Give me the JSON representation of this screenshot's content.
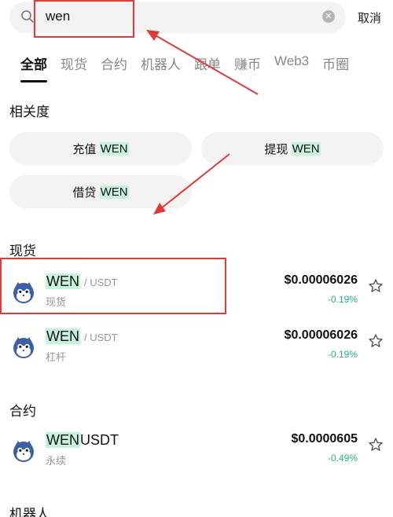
{
  "search": {
    "query": "wen",
    "cancel_label": "取消"
  },
  "tabs": [
    {
      "label": "全部",
      "active": true
    },
    {
      "label": "现货",
      "active": false
    },
    {
      "label": "合约",
      "active": false
    },
    {
      "label": "机器人",
      "active": false
    },
    {
      "label": "跟单",
      "active": false
    },
    {
      "label": "赚币",
      "active": false
    },
    {
      "label": "Web3",
      "active": false
    },
    {
      "label": "币圈",
      "active": false
    }
  ],
  "relevance": {
    "title": "相关度",
    "chips": [
      {
        "prefix": "充值",
        "keyword": "WEN"
      },
      {
        "prefix": "提现",
        "keyword": "WEN"
      },
      {
        "prefix": "借贷",
        "keyword": "WEN"
      }
    ]
  },
  "spot": {
    "title": "现货",
    "rows": [
      {
        "base": "WEN",
        "quote": "/ USDT",
        "subtitle": "现货",
        "price": "$0.00006026",
        "change": "-0.19%"
      },
      {
        "base": "WEN",
        "quote": "/ USDT",
        "subtitle": "杠杆",
        "price": "$0.00006026",
        "change": "-0.19%"
      }
    ]
  },
  "futures": {
    "title": "合约",
    "rows": [
      {
        "base": "WEN",
        "suffix": "USDT",
        "subtitle": "永续",
        "price": "$0.0000605",
        "change": "-0.49%"
      }
    ]
  },
  "bots": {
    "title": "机器人"
  },
  "icons": {
    "search": "search-icon",
    "clear": "clear-icon",
    "star": "star-icon",
    "coin": "wen-coin-avatar"
  },
  "colors": {
    "highlight": "#c7f2dd",
    "change_green": "#1fb77f",
    "annotation_red": "#e53935",
    "search_bg": "#f3f3f4"
  }
}
